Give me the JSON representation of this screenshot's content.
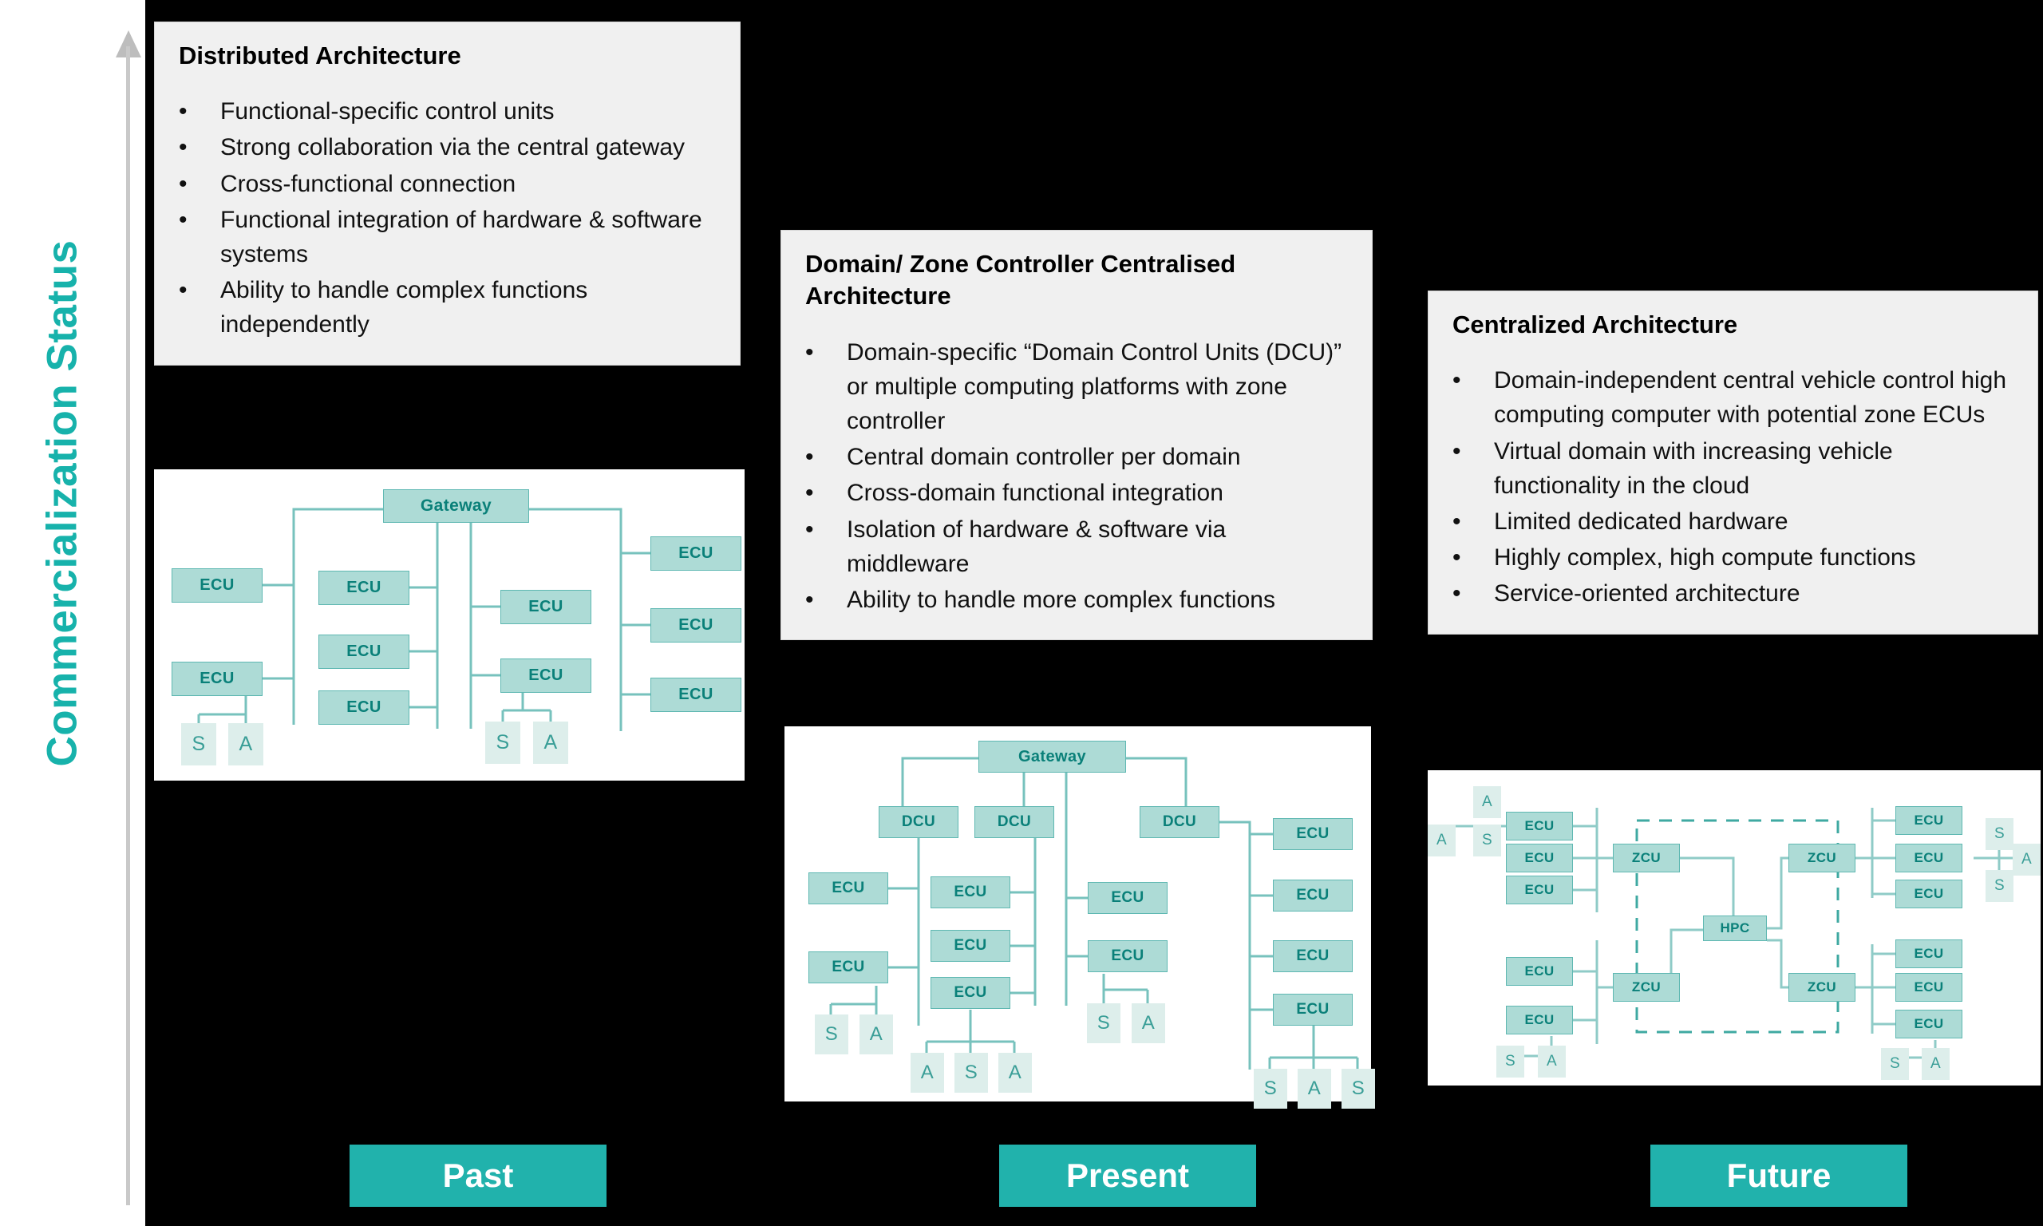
{
  "axis": {
    "label": "Commercialization Status",
    "color": "#17B2AB",
    "direction": "up"
  },
  "colors": {
    "accent_teal": "#21b2ac",
    "node_fill": "#addbd6",
    "node_border": "#5fb8b2",
    "node_text": "#0a8079",
    "sa_fill": "#ddeeeb",
    "card_bg": "#f0f0f0",
    "canvas_bg": "#000000"
  },
  "cards": [
    {
      "id": "past",
      "title": "Distributed Architecture",
      "bullets": [
        "Functional-specific control units",
        "Strong collaboration via the central gateway",
        "Cross-functional connection",
        "Functional integration of hardware & software systems",
        "Ability to handle complex functions independently"
      ]
    },
    {
      "id": "present",
      "title": "Domain/ Zone Controller Centralised Architecture",
      "bullets": [
        "Domain-specific “Domain Control Units (DCU)” or multiple computing platforms with zone controller",
        "Central domain controller per domain",
        "Cross-domain functional integration",
        "Isolation of hardware & software via middleware",
        "Ability to handle more complex functions"
      ]
    },
    {
      "id": "future",
      "title": "Centralized Architecture",
      "bullets": [
        "Domain-independent central vehicle control high computing computer with potential zone ECUs",
        "Virtual domain with increasing vehicle functionality in the cloud",
        "Limited dedicated hardware",
        "Highly complex, high compute functions",
        "Service-oriented architecture"
      ]
    }
  ],
  "eras": [
    {
      "id": "past",
      "label": "Past"
    },
    {
      "id": "present",
      "label": "Present"
    },
    {
      "id": "future",
      "label": "Future"
    }
  ],
  "diagrams": {
    "past": {
      "nodes": {
        "gateway": "Gateway",
        "ecu_l1": "ECU",
        "ecu_l2": "ECU",
        "ecu_m1": "ECU",
        "ecu_m2": "ECU",
        "ecu_m3": "ECU",
        "ecu_c1": "ECU",
        "ecu_c2": "ECU",
        "ecu_r1": "ECU",
        "ecu_r2": "ECU",
        "ecu_r3": "ECU",
        "s_left": "S",
        "a_left": "A",
        "s_mid": "S",
        "a_mid": "A"
      }
    },
    "present": {
      "nodes": {
        "gateway": "Gateway",
        "dcu1": "DCU",
        "dcu2": "DCU",
        "dcu3": "DCU",
        "ecu_l1": "ECU",
        "ecu_l2": "ECU",
        "ecu_m1": "ECU",
        "ecu_m2": "ECU",
        "ecu_m3": "ECU",
        "ecu_c1": "ECU",
        "ecu_c2": "ECU",
        "ecu_r1": "ECU",
        "ecu_r2": "ECU",
        "ecu_r3": "ECU",
        "ecu_r4": "ECU",
        "s_left": "S",
        "a_left": "A",
        "a_b1": "A",
        "s_b1": "S",
        "a_b2": "A",
        "s_c": "S",
        "a_c": "A",
        "s_r1": "S",
        "a_r1": "A",
        "s_r2": "S"
      }
    },
    "future": {
      "nodes": {
        "hpc": "HPC",
        "zcu_tl": "ZCU",
        "zcu_tr": "ZCU",
        "zcu_bl": "ZCU",
        "zcu_br": "ZCU",
        "ecu_tl1": "ECU",
        "ecu_tl2": "ECU",
        "ecu_tl3": "ECU",
        "ecu_tr1": "ECU",
        "ecu_tr2": "ECU",
        "ecu_tr3": "ECU",
        "ecu_bl1": "ECU",
        "ecu_bl2": "ECU",
        "ecu_br1": "ECU",
        "ecu_br2": "ECU",
        "ecu_br3": "ECU",
        "a_top": "A",
        "a_tl": "A",
        "s_tl": "S",
        "s_tr1": "S",
        "a_tr": "A",
        "s_tr2": "S",
        "s_bl": "S",
        "a_bl": "A",
        "s_br": "S",
        "a_br": "A"
      }
    }
  }
}
